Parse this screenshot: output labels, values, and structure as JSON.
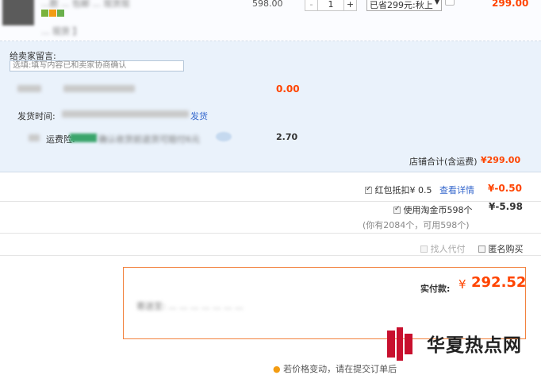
{
  "product": {
    "title_line1": "...款 ... 包邮 ... 现货现",
    "title_line2": "... 现货 】",
    "unit_price": "598.00",
    "quantity": "1",
    "qty_minus": "-",
    "qty_plus": "+",
    "promo_option": "已省299元:秋上",
    "subtotal": "299.00"
  },
  "order_panel": {
    "message_label": "给卖家留言:",
    "message_placeholder": "选填:填写内容已和卖家协商确认",
    "discount_value": "0.00",
    "ship_time_label": "发货时间:",
    "ship_time_suffix": "发货",
    "shipping_label": "运费险:",
    "shipping_note": "确认收货前退货可赔付6元",
    "shipping_value": "2.70",
    "store_total_label": "店铺合计(含运费)",
    "store_total_value": "¥299.00"
  },
  "summary": {
    "redpacket_label": "红包抵扣¥ 0.5",
    "redpacket_link": "查看详情",
    "redpacket_value": "¥-0.50",
    "coins_label": "使用淘金币598个",
    "coins_value": "¥-5.98",
    "coins_note": "(你有2084个，可用598个)",
    "proxy_pay_label": "找人代付",
    "anonymous_label": "匿名购买"
  },
  "payment": {
    "label": "实付款:",
    "currency": "¥",
    "amount": "292.52",
    "address_blur": "寄送至: ... ... ... ... ... ... ..."
  },
  "footer": {
    "notice": "若价格变动，请在提交订单后"
  },
  "watermark": {
    "text": "华夏热点网"
  },
  "colors": {
    "accent": "#ff4400",
    "panel_bg": "#eaf2fb",
    "pay_border": "#f2823e",
    "link": "#3366cc"
  }
}
